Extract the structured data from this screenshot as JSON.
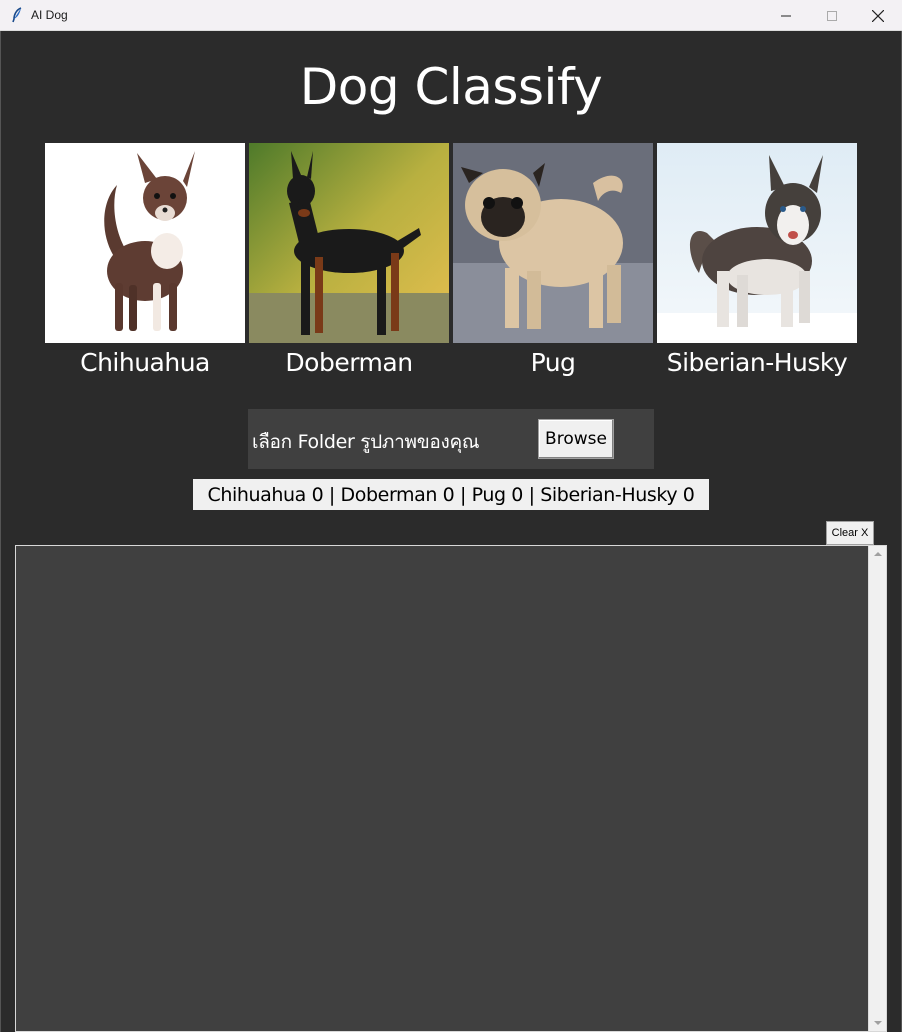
{
  "window": {
    "title": "AI Dog",
    "icon": "feather-icon"
  },
  "header": {
    "title": "Dog Classify"
  },
  "breeds": [
    {
      "label": "Chihuahua"
    },
    {
      "label": "Doberman"
    },
    {
      "label": "Pug"
    },
    {
      "label": "Siberian-Husky"
    }
  ],
  "folder": {
    "label": "เลือก Folder รูปภาพของคุณ",
    "browse_label": "Browse"
  },
  "counts": {
    "text": "Chihuahua 0 | Doberman 0 | Pug 0 | Siberian-Husky 0"
  },
  "output": {
    "clear_label": "Clear X"
  },
  "colors": {
    "background": "#2b2b2b",
    "panel": "#404040",
    "button": "#f0f0f0"
  }
}
